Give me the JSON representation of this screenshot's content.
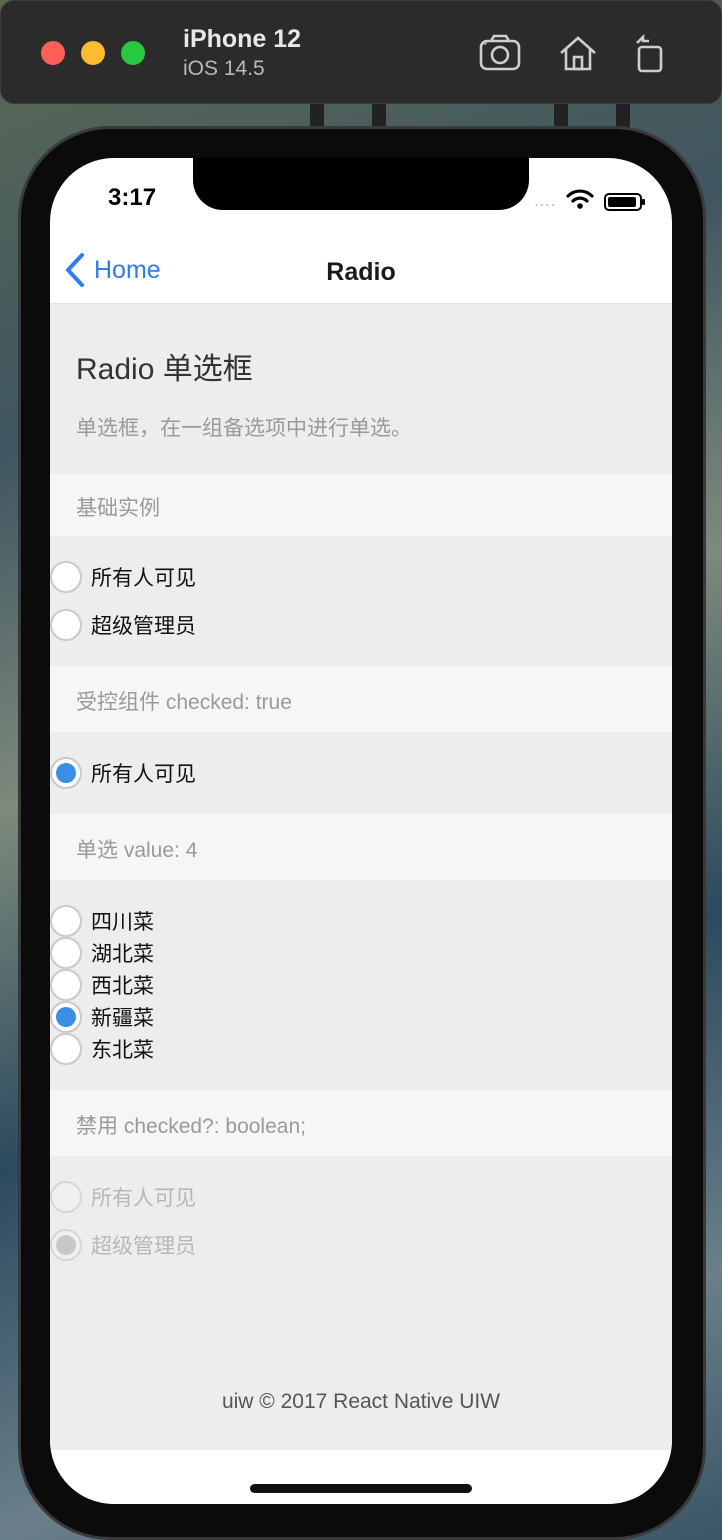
{
  "simulator": {
    "device_name": "iPhone 12",
    "os_version": "iOS 14.5",
    "tools": [
      "screenshot-icon",
      "home-icon",
      "rotate-icon"
    ]
  },
  "status_bar": {
    "time": "3:17",
    "signal": "....",
    "icons": [
      "wifi-icon",
      "battery-icon"
    ]
  },
  "navbar": {
    "back_label": "Home",
    "title": "Radio"
  },
  "page": {
    "title": "Radio 单选框",
    "description": "单选框，在一组备选项中进行单选。"
  },
  "sections": {
    "basic": {
      "title": "基础实例",
      "items": [
        {
          "label": "所有人可见",
          "checked": false
        },
        {
          "label": "超级管理员",
          "checked": false
        }
      ]
    },
    "controlled": {
      "title": "受控组件 checked: true",
      "items": [
        {
          "label": "所有人可见",
          "checked": true
        }
      ]
    },
    "single": {
      "title": "单选 value: 4",
      "items": [
        {
          "label": "四川菜",
          "checked": false
        },
        {
          "label": "湖北菜",
          "checked": false
        },
        {
          "label": "西北菜",
          "checked": false
        },
        {
          "label": "新疆菜",
          "checked": true
        },
        {
          "label": "东北菜",
          "checked": false
        }
      ]
    },
    "disabled": {
      "title": "禁用 checked?: boolean;",
      "items": [
        {
          "label": "所有人可见",
          "checked": false
        },
        {
          "label": "超级管理员",
          "checked": true
        }
      ]
    }
  },
  "footer": {
    "text": "uiw © 2017 React Native UIW"
  },
  "colors": {
    "accent": "#3a8ee6",
    "link": "#2f7cf6",
    "background": "#ededed"
  }
}
